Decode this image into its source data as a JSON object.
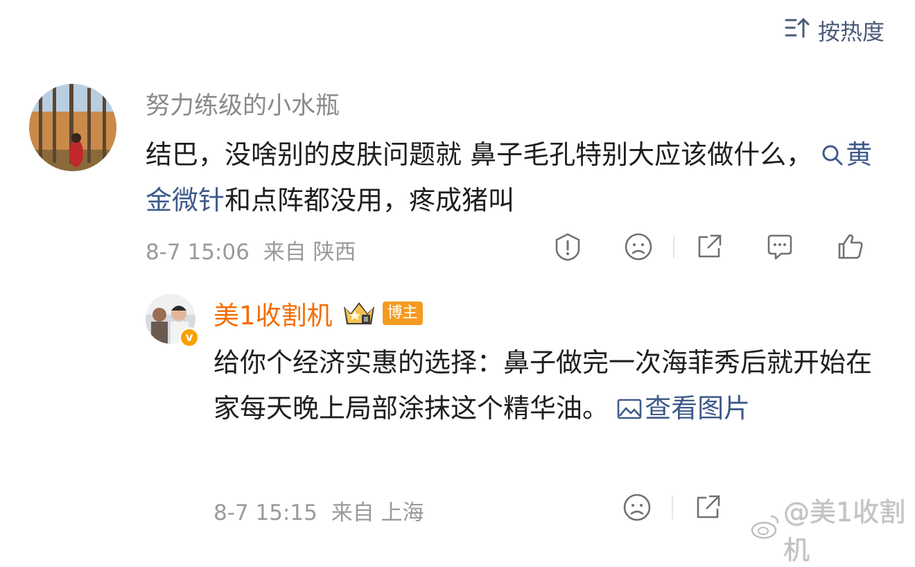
{
  "sort": {
    "label": "按热度",
    "icon": "sort-icon"
  },
  "comment": {
    "username": "努力练级的小水瓶",
    "text_before": "结巴，没啥别的皮肤问题就 鼻子毛孔特别大应该做什么，",
    "topic": "黄金微针",
    "text_after": "和点阵都没用，疼成猪叫",
    "date": "8-7 15:06",
    "source": "来自 陕西",
    "actions": [
      "report-icon",
      "dislike-icon",
      "share-icon",
      "reply-icon",
      "like-icon"
    ]
  },
  "reply": {
    "username": "美1收割机",
    "badge": "博主",
    "verified_mark": "v",
    "text": "给你个经济实惠的选择：鼻子做完一次海菲秀后就开始在家每天晚上局部涂抹这个精华油。",
    "image_link": "查看图片",
    "date": "8-7 15:15",
    "source": "来自 上海",
    "actions": [
      "dislike-icon",
      "share-icon"
    ]
  },
  "watermark": {
    "text": "@美1收割机"
  },
  "colors": {
    "link": "#3f5a8a",
    "username_highlight": "#f36d00",
    "badge": "#f59a22",
    "meta": "#9a9a9a"
  }
}
